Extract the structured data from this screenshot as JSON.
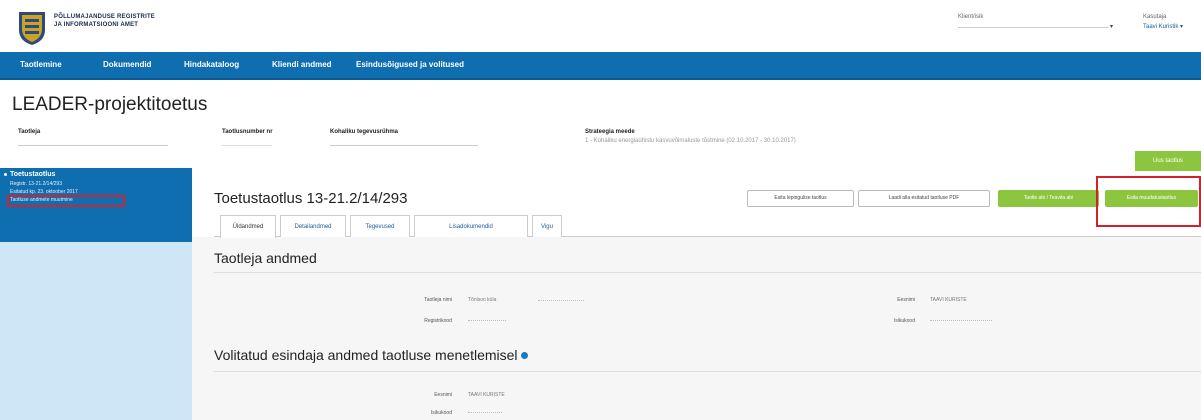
{
  "header": {
    "logo_line1": "PÕLLUMAJANDUSE REGISTRITE",
    "logo_line2": "JA INFORMATSIOONI AMET",
    "client_label": "Klient/isik",
    "client_value": "",
    "user_label": "Kasutaja",
    "user_value": "Taavi Kuristik"
  },
  "nav": {
    "items": [
      "Taotlemine",
      "Dokumendid",
      "Hindakataloog",
      "Kliendi andmed",
      "Esindusõigused ja volitused"
    ]
  },
  "page": {
    "title": "LEADER-projektitoetus",
    "applicant_label": "Taotleja",
    "application_no_label": "Taotlusnumber nr",
    "action_group_label": "Kohaliku tegevusrühma",
    "strategy_label": "Strateegia meede",
    "strategy_value": "1 - Kohaliku energiaühistu kasvuvõimaluste tõstmine (02.10.2017 - 30.10.2017)",
    "top_button": "Uus taotlus"
  },
  "sidebar": {
    "title": "Toetustaotlus",
    "line1": "Registr. 13-21.2/14/293",
    "line2": "Esitatud kp. 23. oktoober 2017",
    "line3": "Taotluse andmete muutmine"
  },
  "main": {
    "title": "Toetustaotlus 13-21.2/14/293",
    "buttons": {
      "b1": "Esita lepingulise taotlus",
      "b2": "Laadi alla esitatud taotluse PDF",
      "b3": "Taotle abi / Teavita abi",
      "b4": "Esita muudatustaotlus"
    },
    "tabs": [
      "Üldandmed",
      "Detailandmed",
      "Tegevused",
      "Lisadokumendid",
      "Vigu"
    ],
    "section1_title": "Taotleja andmed",
    "section2_title": "Volitatud esindaja andmed taotluse menetlemisel",
    "applicant": {
      "name_label": "Taotleja nimi",
      "name_value": "Tõnisoo küla",
      "reg_label": "Registrikood",
      "reg_value": "",
      "first_name_label": "Eesnimi",
      "first_name_value": "TAAVI KURISTE",
      "id_label": "Isikukood",
      "id_value": ""
    },
    "representative": {
      "first_name_label": "Eesnimi",
      "first_name_value": "TAAVI KURISTE",
      "id_label": "Isikukood",
      "id_value": ""
    }
  }
}
